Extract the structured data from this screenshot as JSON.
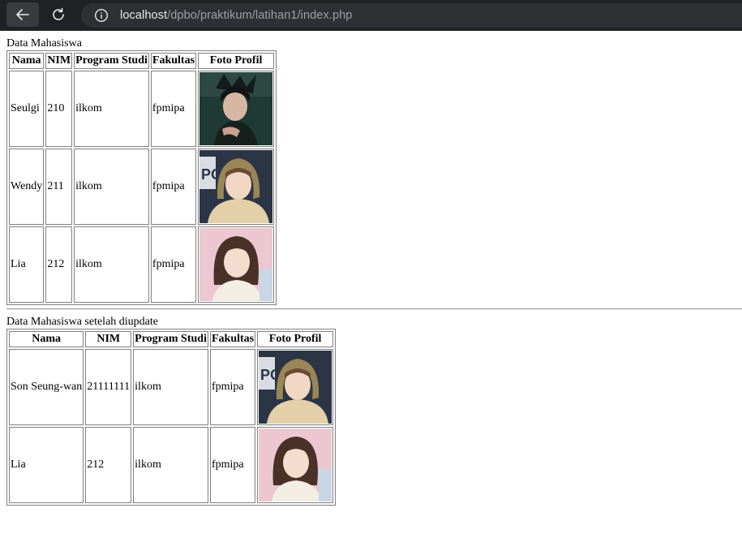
{
  "browser": {
    "url_host": "localhost",
    "url_path": "/dpbo/praktikum/latihan1/index.php"
  },
  "section1": {
    "caption": "Data Mahasiswa",
    "headers": [
      "Nama",
      "NIM",
      "Program Studi",
      "Fakultas",
      "Foto Profil"
    ],
    "rows": [
      {
        "nama": "Seulgi",
        "nim": "210",
        "prodi": "ilkom",
        "fakultas": "fpmipa"
      },
      {
        "nama": "Wendy",
        "nim": "211",
        "prodi": "ilkom",
        "fakultas": "fpmipa"
      },
      {
        "nama": "Lia",
        "nim": "212",
        "prodi": "ilkom",
        "fakultas": "fpmipa"
      }
    ]
  },
  "section2": {
    "caption": "Data Mahasiswa setelah diupdate",
    "headers": [
      "Nama",
      "NIM",
      "Program Studi",
      "Fakultas",
      "Foto Profil"
    ],
    "rows": [
      {
        "nama": "Son Seung-wan",
        "nim": "21111111",
        "prodi": "ilkom",
        "fakultas": "fpmipa"
      },
      {
        "nama": "Lia",
        "nim": "212",
        "prodi": "ilkom",
        "fakultas": "fpmipa"
      }
    ]
  }
}
